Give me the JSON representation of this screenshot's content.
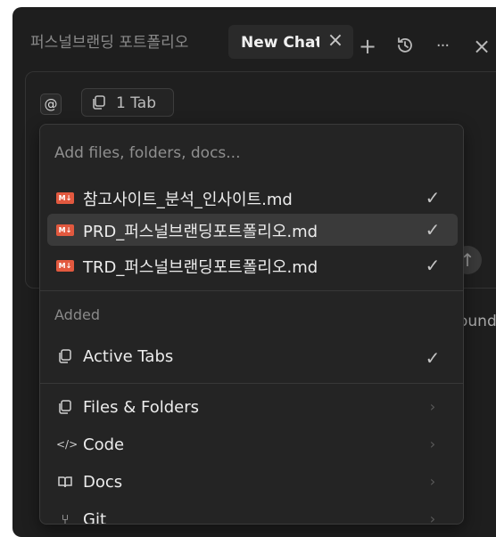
{
  "tabs": [
    {
      "label": "퍼스널브랜딩 포트폴리오"
    },
    {
      "label": "New Chat"
    }
  ],
  "toolbar": {
    "close_tab_glyph": "×",
    "new_tab_glyph": "+",
    "more_glyph": "···",
    "close_glyph": "×",
    "icons": [
      "plus-icon",
      "history-icon",
      "more-icon",
      "close-icon"
    ]
  },
  "composer": {
    "mention_glyph": "@",
    "tab_chip_label": "1 Tab",
    "send_glyph": "↑",
    "partial_text": "ound"
  },
  "dropdown": {
    "search_placeholder": "Add files, folders, docs...",
    "files": [
      {
        "badge": "M↓",
        "name": "참고사이트_분석_인사이트.md",
        "checked": true,
        "selected": false
      },
      {
        "badge": "M↓",
        "name": "PRD_퍼스널브랜딩포트폴리오.md",
        "checked": true,
        "selected": true
      },
      {
        "badge": "M↓",
        "name": "TRD_퍼스널브랜딩포트폴리오.md",
        "checked": true,
        "selected": false
      }
    ],
    "added_label": "Added",
    "added_items": [
      {
        "label": "Active Tabs",
        "icon": "copy-icon",
        "checked": true
      }
    ],
    "menu_items": [
      {
        "label": "Files & Folders",
        "icon": "copy-icon",
        "glyph": "⧉"
      },
      {
        "label": "Code",
        "icon": "code-icon",
        "glyph": "</>"
      },
      {
        "label": "Docs",
        "icon": "book-icon",
        "glyph": "🕮"
      },
      {
        "label": "Git",
        "icon": "git-icon",
        "glyph": "⑂"
      }
    ],
    "check_glyph": "✓",
    "chevron_glyph": "›"
  },
  "colors": {
    "background": "#1e1e1e",
    "dropdown": "#242424",
    "selected_row": "#3a3a3a",
    "md_badge": "#e2593f"
  }
}
